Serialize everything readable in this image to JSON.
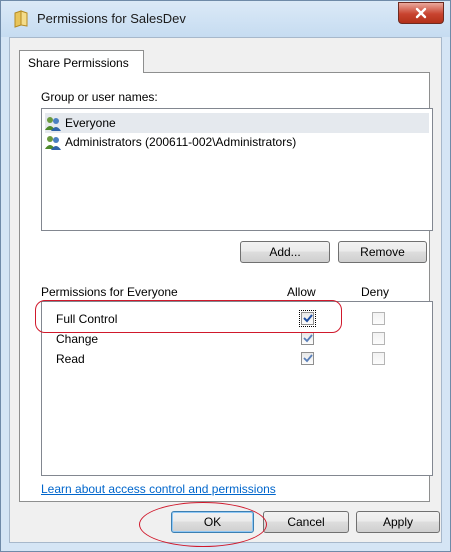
{
  "window": {
    "title": "Permissions for SalesDev",
    "close_label": "x"
  },
  "tabs": [
    {
      "label": "Share Permissions"
    }
  ],
  "groups": {
    "label": "Group or user names:",
    "items": [
      {
        "name": "Everyone",
        "selected": true
      },
      {
        "name": "Administrators (200611-002\\Administrators)",
        "selected": false
      }
    ],
    "add_label": "Add...",
    "remove_label": "Remove"
  },
  "permissions": {
    "label": "Permissions for Everyone",
    "allow_header": "Allow",
    "deny_header": "Deny",
    "rows": [
      {
        "name": "Full Control",
        "allow": true,
        "deny": false
      },
      {
        "name": "Change",
        "allow": true,
        "deny": false
      },
      {
        "name": "Read",
        "allow": true,
        "deny": false
      }
    ]
  },
  "link": {
    "label": "Learn about access control and permissions"
  },
  "footer": {
    "ok_label": "OK",
    "cancel_label": "Cancel",
    "apply_label": "Apply"
  },
  "colors": {
    "annotation": "#d0192c",
    "link": "#0066cc",
    "check": "#1f4fa3"
  },
  "icons": {
    "title": "folder-icon",
    "user": "users-group-icon",
    "close": "close-icon"
  }
}
